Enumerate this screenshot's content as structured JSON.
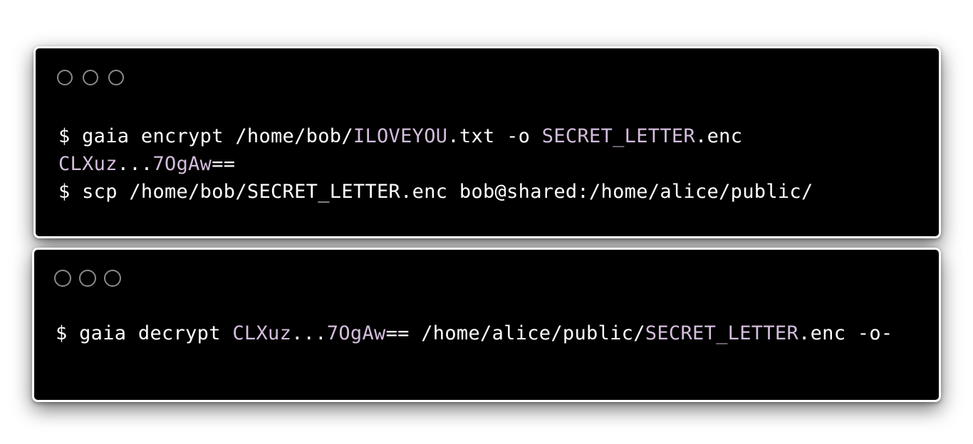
{
  "colors": {
    "background": "#ffffff",
    "terminal_bg": "#000000",
    "text": "#ffffff",
    "highlight": "#d3bddc",
    "window_dot": "#8a8a8a"
  },
  "terminal_1": {
    "lines": [
      [
        {
          "t": "$ gaia encrypt /home/bob/",
          "hl": false
        },
        {
          "t": "ILOVEYOU",
          "hl": true
        },
        {
          "t": ".txt -o ",
          "hl": false
        },
        {
          "t": "SECRET_LETTER",
          "hl": true
        },
        {
          "t": ".enc",
          "hl": false
        }
      ],
      [
        {
          "t": "CLXuz",
          "hl": true
        },
        {
          "t": "...",
          "hl": false
        },
        {
          "t": "7OgAw",
          "hl": true
        },
        {
          "t": "==",
          "hl": false
        }
      ],
      [
        {
          "t": "$ scp /home/bob/SECRET_LETTER.enc bob@shared:/home/alice/public/",
          "hl": false
        }
      ]
    ]
  },
  "terminal_2": {
    "lines": [
      [
        {
          "t": "$ gaia decrypt ",
          "hl": false
        },
        {
          "t": "CLXuz",
          "hl": true
        },
        {
          "t": "...",
          "hl": false
        },
        {
          "t": "7OgAw",
          "hl": true
        },
        {
          "t": "== /home/alice/public/",
          "hl": false
        },
        {
          "t": "SECRET_LETTER",
          "hl": true
        },
        {
          "t": ".enc -o-",
          "hl": false
        }
      ]
    ]
  }
}
